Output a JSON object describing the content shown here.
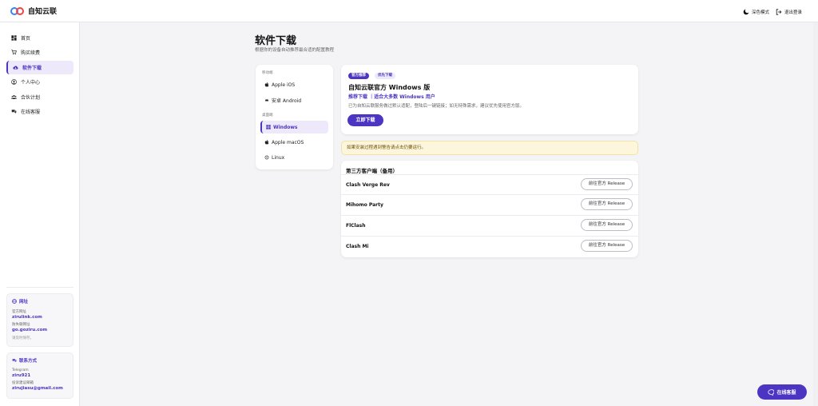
{
  "brand": {
    "name": "自知云联"
  },
  "topbar": {
    "dark_mode": "深色模式",
    "logout": "退出登录"
  },
  "sidebar": {
    "items": [
      {
        "label": "首页",
        "icon": "dashboard-icon"
      },
      {
        "label": "购买续费",
        "icon": "cart-icon"
      },
      {
        "label": "软件下载",
        "icon": "cloud-download-icon",
        "active": true
      },
      {
        "label": "个人中心",
        "icon": "user-icon"
      },
      {
        "label": "合伙计划",
        "icon": "team-icon"
      },
      {
        "label": "在线客服",
        "icon": "chat-icon"
      }
    ],
    "site_card": {
      "title": "网址",
      "official_label": "官方网址",
      "official_url": "zirulink.com",
      "backup_label": "防失联网址",
      "backup_url": "go.goziru.com",
      "note": "请及时保存。"
    },
    "contact_card": {
      "title": "联系方式",
      "telegram_label": "Telegram",
      "telegram_value": "ziru921",
      "email_label": "投诉建议邮箱",
      "email_value": "zirujiasu@gmail.com"
    }
  },
  "main": {
    "title": "软件下载",
    "subtitle": "根据你的设备自动推荐最合适的配置教程",
    "platforms": {
      "mobile_group": "移动端",
      "desktop_group": "桌面端",
      "mobile": [
        {
          "label": "Apple iOS",
          "icon": "apple-icon"
        },
        {
          "label": "安卓 Android",
          "icon": "android-icon"
        }
      ],
      "desktop": [
        {
          "label": "Windows",
          "icon": "windows-icon",
          "active": true
        },
        {
          "label": "Apple macOS",
          "icon": "apple-icon"
        },
        {
          "label": "Linux",
          "icon": "linux-icon"
        }
      ]
    },
    "windows": {
      "badge_official": "官方推荐",
      "badge_priority": "优先下载",
      "title": "自知云联官方 Windows 版",
      "recommend": "推荐下载 ｜适合大多数 Windows 用户",
      "description": "已为自知云联服务做过默认适配，登陆后一键链接；如无特殊需求，建议优先使用官方版。",
      "download_label": "立即下载"
    },
    "warning": "如果安装过程遇到警告请点击仍要运行。",
    "third_party": {
      "title": "第三方客户端（备用）",
      "button_label": "前往官方 Release",
      "clients": [
        "Clash Verge Rev",
        "Mihomo Party",
        "FlClash",
        "Clash Mi"
      ]
    }
  },
  "support_button": "在线客服",
  "colors": {
    "accent": "#4c35c2",
    "accent_light": "#ede9fb",
    "warning_bg": "#fdf6dc"
  }
}
